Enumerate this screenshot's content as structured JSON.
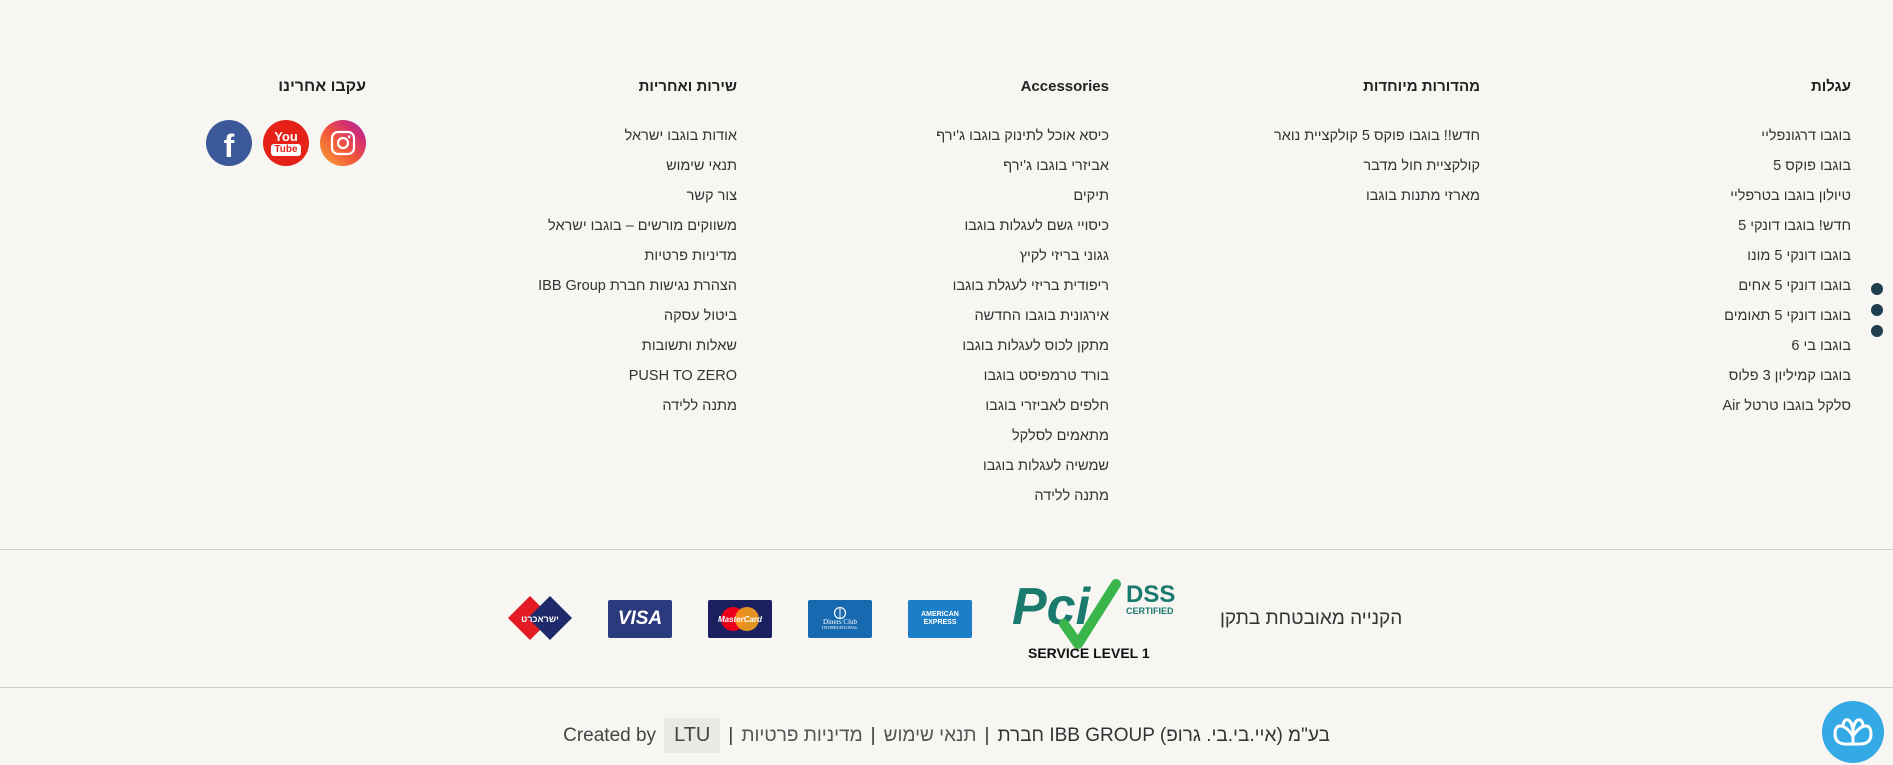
{
  "footer": {
    "columns": [
      {
        "title": "עגלות",
        "items": [
          "בוגבו דרגונפליי",
          "בוגבו פוקס 5",
          "טיולון בוגבו בטרפליי",
          "חדש! בוגבו דונקי 5",
          "בוגבו דונקי 5 מונו",
          "בוגבו דונקי 5 אחים",
          "בוגבו דונקי 5 תאומים",
          "בוגבו בי 6",
          "בוגבו קמיליון 3 פלוס",
          "סלקל בוגבו טרטל Air"
        ]
      },
      {
        "title": "מהדורות מיוחדות",
        "items": [
          "חדש!! בוגבו פוקס 5 קולקציית נואר",
          "קולקציית חול מדבר",
          "מארזי מתנות בוגבו"
        ]
      },
      {
        "title": "Accessories",
        "items": [
          "כיסא אוכל לתינוק בוגבו ג'ירף",
          "אביזרי בוגבו ג'ירף",
          "תיקים",
          "כיסויי גשם לעגלות בוגבו",
          "גגוני בריזי לקיץ",
          "ריפודית בריזי לעגלת בוגבו",
          "אירגונית בוגבו החדשה",
          "מתקן לכוס לעגלות בוגבו",
          "בורד טרמפיסט בוגבו",
          "חלפים לאביזרי בוגבו",
          "מתאמים לסלקל",
          "שמשיה לעגלות בוגבו",
          "מתנה ללידה"
        ]
      },
      {
        "title": "שירות ואחריות",
        "items": [
          "אודות בוגבו ישראל",
          "תנאי שימוש",
          "צור קשר",
          "משווקים מורשים – בוגבו ישראל",
          "מדיניות פרטיות",
          "הצהרת נגישות חברת IBB Group",
          "ביטול עסקה",
          "שאלות ותשובות",
          "PUSH TO ZERO",
          "מתנה ללידה"
        ]
      }
    ],
    "social": {
      "title": "עקבו אחרינו",
      "icons": [
        "instagram-icon",
        "youtube-icon",
        "facebook-icon"
      ],
      "youtube_text_1": "You",
      "youtube_text_2": "Tube",
      "facebook_text": "f"
    }
  },
  "payment": {
    "secure_text": "הקנייה מאובטחת בתקן",
    "pci_main": "Pci",
    "pci_dss": "DSS",
    "pci_certified": "CERTIFIED",
    "pci_level": "SERVICE LEVEL 1",
    "cards": {
      "amex_1": "AMERICAN",
      "amex_2": "EXPRESS",
      "diners_1": "Diners Club",
      "diners_2": "INTERNATIONAL",
      "mastercard": "MasterCard",
      "visa": "VISA",
      "isracard": "ישראכרט"
    }
  },
  "credits": {
    "created_by": "Created by",
    "ltu": "LTU",
    "sep": "|",
    "privacy": "מדיניות פרטיות",
    "terms": "תנאי שימוש",
    "company": "חברת IBB GROUP (איי.בי.בי. גרופ) בע\"מ"
  },
  "colors": {
    "background": "#f7f6f2",
    "accent_dark": "#1f3f4f",
    "chat": "#33a9e5",
    "pci_teal": "#1a7a6e",
    "pci_green": "#39b54a"
  }
}
